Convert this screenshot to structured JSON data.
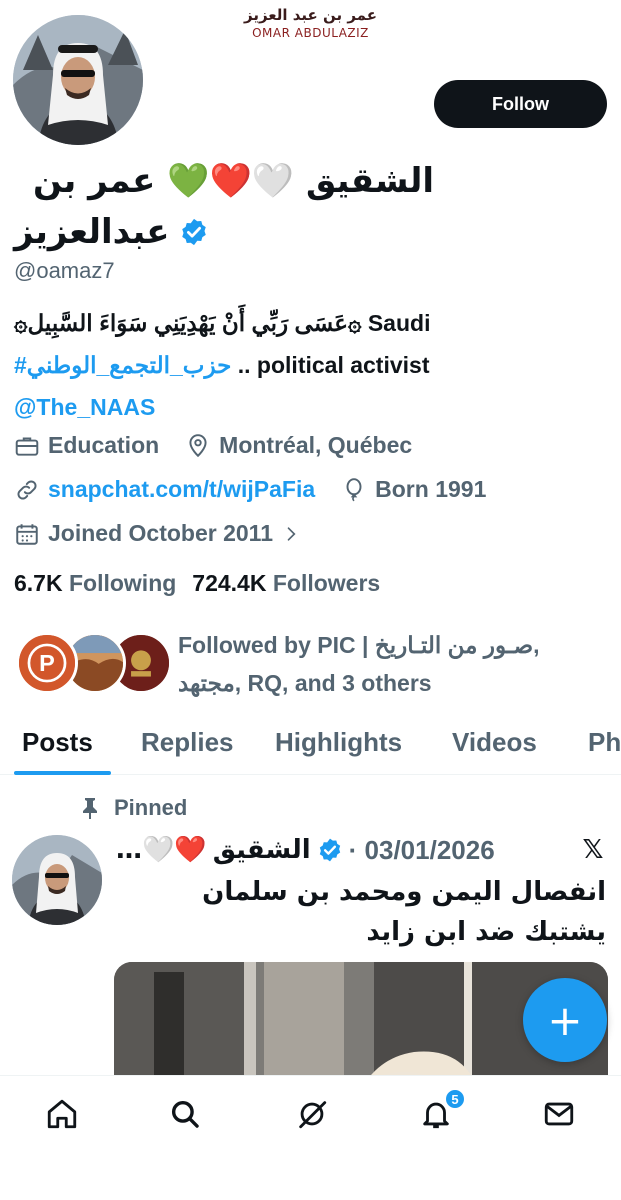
{
  "banner": {
    "title_ar": "عمر بن عبد العزيز",
    "title_en": "OMAR ABDULAZIZ"
  },
  "profile": {
    "display_name_line1": "الشقيق 🤍❤️💚 عمر بن",
    "display_name_line2": "عبدالعزيز",
    "handle": "@oamaz7",
    "follow_label": "Follow",
    "verified_icon": "verified-badge-icon",
    "bio_line1": "۞عَسَى رَبِّي أَنْ يَهْدِيَنِي سَوَاءَ السَّبِيل۞ Saudi",
    "bio_line2_link": "#حزب_التجمع_الوطني",
    "bio_line2_text": " .. political activist",
    "bio_line3_link": "@The_NAAS",
    "category": "Education",
    "location": "Montréal, Québec",
    "website": "snapchat.com/t/wijPaFia",
    "born": "Born 1991",
    "joined": "Joined October 2011",
    "following_count": "6.7K",
    "following_label": "Following",
    "followers_count": "724.4K",
    "followers_label": "Followers",
    "followed_by_line1": "Followed by PIC | صـور من التـاريخ,",
    "followed_by_line2": "مجتهد, RQ, and 3 others"
  },
  "tabs": [
    {
      "label": "Posts",
      "active": true
    },
    {
      "label": "Replies",
      "active": false
    },
    {
      "label": "Highlights",
      "active": false
    },
    {
      "label": "Videos",
      "active": false
    },
    {
      "label": "Ph",
      "active": false
    }
  ],
  "pinned_post": {
    "pinned_label": "Pinned",
    "author": "الشقيق",
    "author_emoji": "…🤍❤️",
    "date": "· 03/01/2026",
    "text": "انفصال اليمن ومحمد بن سلمان يشتبك ضد ابن زايد",
    "source_icon": "𝕏"
  },
  "fab_label": "+",
  "nav": {
    "items": [
      "home-icon",
      "search-icon",
      "grok-icon",
      "notifications-icon",
      "messages-icon"
    ],
    "notification_badge": "5"
  },
  "colors": {
    "accent": "#1d9bf0",
    "text_primary": "#0f1419",
    "text_secondary": "#536471"
  }
}
